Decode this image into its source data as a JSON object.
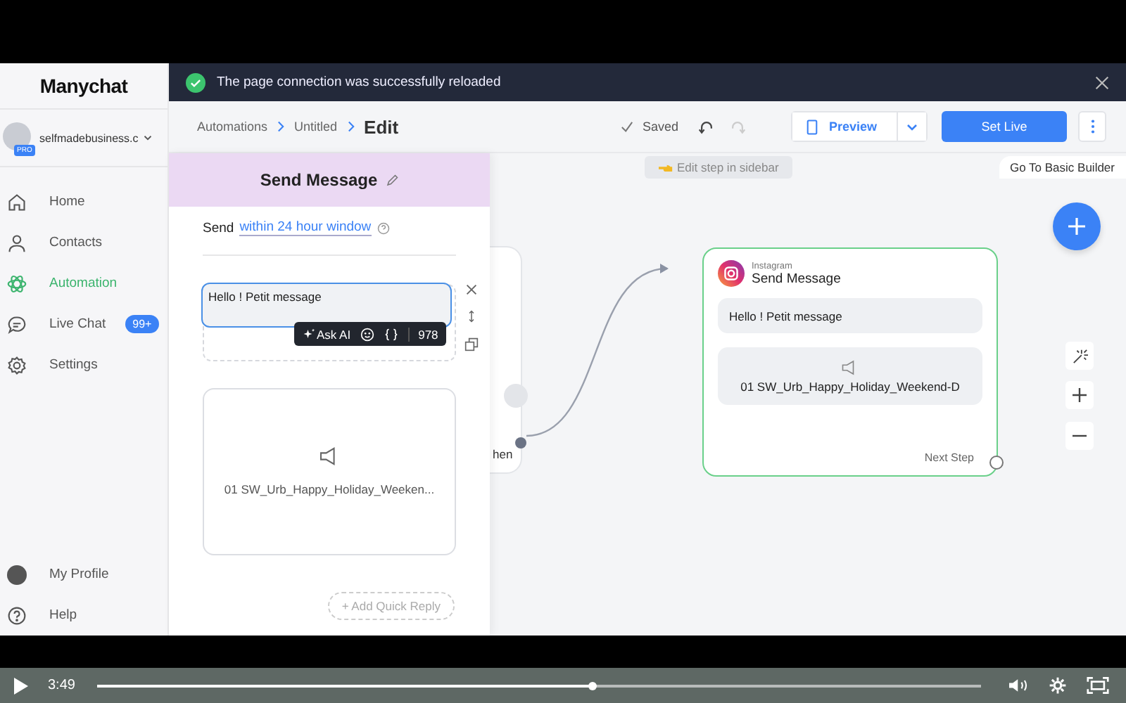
{
  "app": {
    "logo": "Manychat"
  },
  "account": {
    "name": "selfmadebusiness.c",
    "badge": "PRO"
  },
  "nav": [
    {
      "label": "Home",
      "kind": "home",
      "selected": false
    },
    {
      "label": "Contacts",
      "kind": "person",
      "selected": false
    },
    {
      "label": "Automation",
      "kind": "atom",
      "selected": true
    },
    {
      "label": "Live Chat",
      "kind": "chat",
      "selected": false,
      "badge": "99+"
    },
    {
      "label": "Settings",
      "kind": "gear",
      "selected": false
    }
  ],
  "nav_bottom": [
    {
      "label": "My Profile",
      "kind": "avatar"
    },
    {
      "label": "Help",
      "kind": "help"
    }
  ],
  "toast": {
    "message": "The page connection was successfully reloaded"
  },
  "breadcrumb": [
    "Automations",
    "Untitled",
    "Edit"
  ],
  "toolbar": {
    "status": "Saved",
    "preview": "Preview",
    "set_live": "Set Live",
    "tooltip": "Go To Basic Builder"
  },
  "editor": {
    "title": "Send Message",
    "send_prefix": "Send",
    "send_window": "within 24 hour window",
    "message": "Hello ! Petit message",
    "ai": "Ask AI",
    "char_count": "978",
    "audio_file": "01 SW_Urb_Happy_Holiday_Weeken...",
    "quick_reply": "+ Add Quick Reply"
  },
  "canvas": {
    "hint": "Edit step in sidebar",
    "hidden_node": {
      "label": "hen"
    },
    "node": {
      "channel": "Instagram",
      "title": "Send Message",
      "message": "Hello ! Petit message",
      "audio_file": "01 SW_Urb_Happy_Holiday_Weekend-D",
      "next": "Next Step"
    }
  },
  "player": {
    "time": "3:49",
    "level": 0.56
  }
}
